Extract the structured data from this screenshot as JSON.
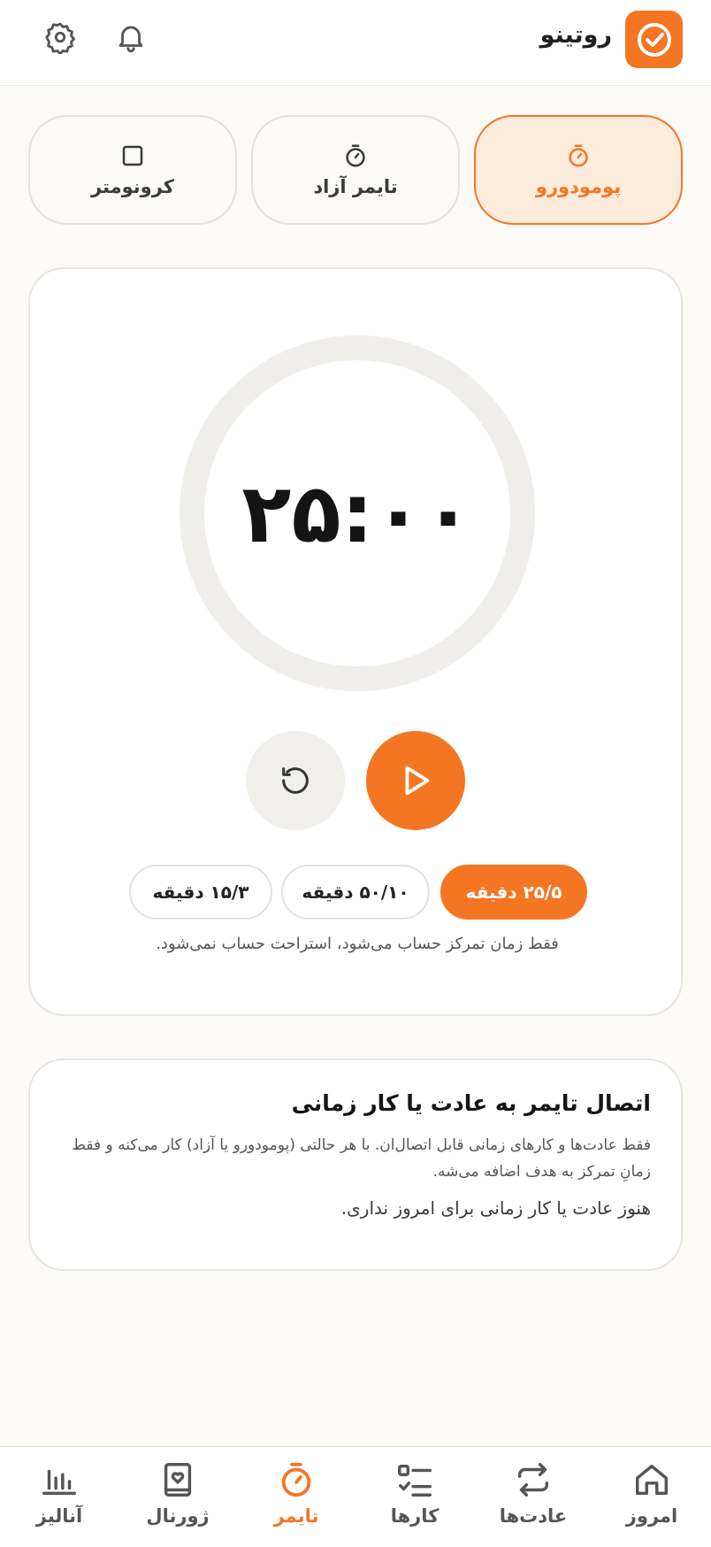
{
  "app": {
    "title": "روتینو"
  },
  "colors": {
    "accent": "#f47623",
    "ring": "#efeeea",
    "card_bg": "#ffffff",
    "page_bg": "#fbfaf7"
  },
  "modes": [
    {
      "id": "pomodoro",
      "label": "پومودورو",
      "icon": "stopwatch-icon",
      "active": true
    },
    {
      "id": "free",
      "label": "تایمر آزاد",
      "icon": "stopwatch-icon",
      "active": false
    },
    {
      "id": "chrono",
      "label": "کرونومتر",
      "icon": "square-icon",
      "active": false
    }
  ],
  "timer": {
    "display": "۲۵:۰۰",
    "progress": 0
  },
  "presets": [
    {
      "label": "۲۵/۵ دقیقه",
      "active": true
    },
    {
      "label": "۵۰/۱۰ دقیقه",
      "active": false
    },
    {
      "label": "۱۵/۳ دقیقه",
      "active": false
    }
  ],
  "note": "فقط زمان تمرکز حساب می‌شود، استراحت حساب نمی‌شود.",
  "link_card": {
    "title": "اتصال تایمر به عادت یا کار زمانی",
    "description": "فقط عادت‌ها و کارهای زمانی قابل اتصال‌ان. با هر حالتی (پومودورو یا آزاد) کار می‌کنه و فقط زمانِ تمرکز به هدف اضافه می‌شه.",
    "empty": "هنوز عادت یا کار زمانی برای امروز نداری."
  },
  "nav": [
    {
      "label": "امروز",
      "icon": "home-icon",
      "active": false
    },
    {
      "label": "عادت‌ها",
      "icon": "repeat-icon",
      "active": false
    },
    {
      "label": "کارها",
      "icon": "checklist-icon",
      "active": false
    },
    {
      "label": "تایمر",
      "icon": "stopwatch-icon",
      "active": true
    },
    {
      "label": "ژورنال",
      "icon": "journal-icon",
      "active": false
    },
    {
      "label": "آنالیز",
      "icon": "bar-chart-icon",
      "active": false
    }
  ]
}
